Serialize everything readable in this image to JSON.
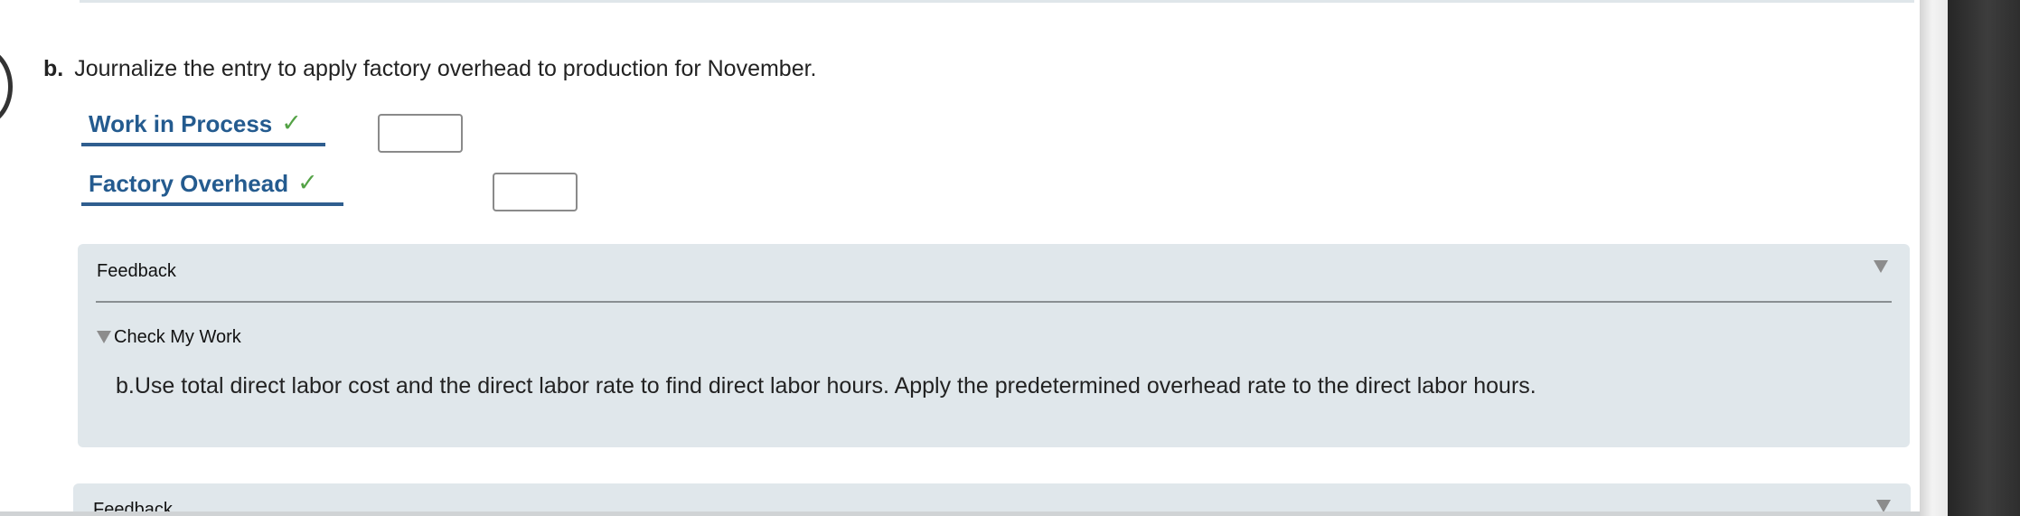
{
  "question": {
    "letter": "b.",
    "text": "Journalize the entry to apply factory overhead to production for November."
  },
  "journal": {
    "entries": [
      {
        "account": "Work in Process",
        "status_icon": "check-icon",
        "amount_value": "",
        "amount_placeholder": ""
      },
      {
        "account": "Factory Overhead",
        "status_icon": "check-icon",
        "amount_value": "",
        "amount_placeholder": ""
      }
    ]
  },
  "feedback": {
    "title": "Feedback",
    "collapse_icon": "triangle-down-icon",
    "check_my_work": {
      "label": "Check My Work",
      "icon": "triangle-down-icon"
    },
    "hint": "b.Use total direct labor cost and the direct labor rate to find direct labor hours. Apply the predetermined overhead rate to the direct labor hours."
  },
  "next_feedback": {
    "title": "Feedback",
    "collapse_icon": "triangle-down-icon"
  },
  "colors": {
    "account_text": "#245b8f",
    "account_underline": "#2f5e8f",
    "check_mark": "#53a245",
    "feedback_panel": "#e0e7eb",
    "right_scroll_edge": "#2f2f2f"
  }
}
